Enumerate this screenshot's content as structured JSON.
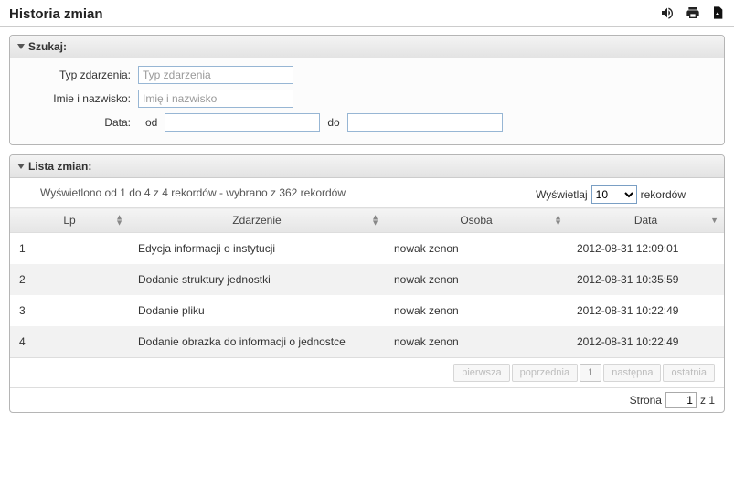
{
  "header": {
    "title": "Historia zmian"
  },
  "search": {
    "panel_title": "Szukaj:",
    "event_type_label": "Typ zdarzenia:",
    "event_type_placeholder": "Typ zdarzenia",
    "name_label": "Imie i nazwisko:",
    "name_placeholder": "Imię i nazwisko",
    "date_label": "Data:",
    "from_label": "od",
    "to_label": "do"
  },
  "list": {
    "panel_title": "Lista zmian:",
    "records_info": "Wyświetlono od 1 do 4 z 4 rekordów - wybrano z 362 rekordów",
    "page_size_prefix": "Wyświetlaj",
    "page_size_value": "10",
    "page_size_suffix": "rekordów",
    "columns": {
      "lp": "Lp",
      "event": "Zdarzenie",
      "person": "Osoba",
      "date": "Data"
    },
    "rows": [
      {
        "lp": "1",
        "event": "Edycja informacji o instytucji",
        "person": "nowak zenon",
        "date": "2012-08-31 12:09:01"
      },
      {
        "lp": "2",
        "event": "Dodanie struktury jednostki",
        "person": "nowak zenon",
        "date": "2012-08-31 10:35:59"
      },
      {
        "lp": "3",
        "event": "Dodanie pliku",
        "person": "nowak zenon",
        "date": "2012-08-31 10:22:49"
      },
      {
        "lp": "4",
        "event": "Dodanie obrazka do informacji o jednostce",
        "person": "nowak zenon",
        "date": "2012-08-31 10:22:49"
      }
    ],
    "pager": {
      "first": "pierwsza",
      "prev": "poprzednia",
      "current": "1",
      "next": "następna",
      "last": "ostatnia"
    },
    "page_info": {
      "prefix": "Strona",
      "value": "1",
      "suffix": "z 1"
    }
  }
}
